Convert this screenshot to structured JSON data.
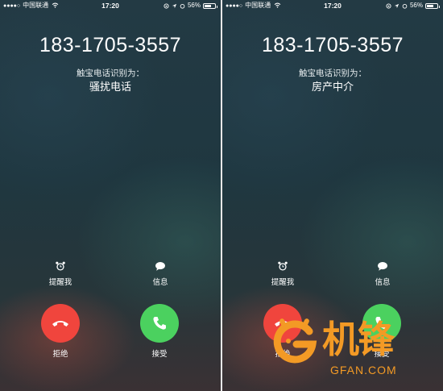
{
  "screens": [
    {
      "status": {
        "carrier": "中国联通",
        "time": "17:20",
        "battery": "56%",
        "battery_level": 0.56
      },
      "caller_number": "183-1705-3557",
      "id_label": "触宝电话识别为：",
      "id_value": "骚扰电话",
      "remind_label": "提醒我",
      "message_label": "信息",
      "decline_label": "拒绝",
      "accept_label": "接受"
    },
    {
      "status": {
        "carrier": "中国联通",
        "time": "17:20",
        "battery": "56%",
        "battery_level": 0.56
      },
      "caller_number": "183-1705-3557",
      "id_label": "触宝电话识别为：",
      "id_value": "房产中介",
      "remind_label": "提醒我",
      "message_label": "信息",
      "decline_label": "拒绝",
      "accept_label": "接受"
    }
  ],
  "watermark": {
    "brand": "机锋",
    "site": "GFAN.COM",
    "color": "#f39a25"
  },
  "icons": [
    "alarm-clock-icon",
    "message-bubble-icon",
    "phone-hangup-icon",
    "phone-answer-icon",
    "wifi-icon",
    "location-arrow-icon",
    "rotation-lock-icon"
  ],
  "colors": {
    "decline": "#f0453d",
    "accept": "#4bd15f"
  }
}
